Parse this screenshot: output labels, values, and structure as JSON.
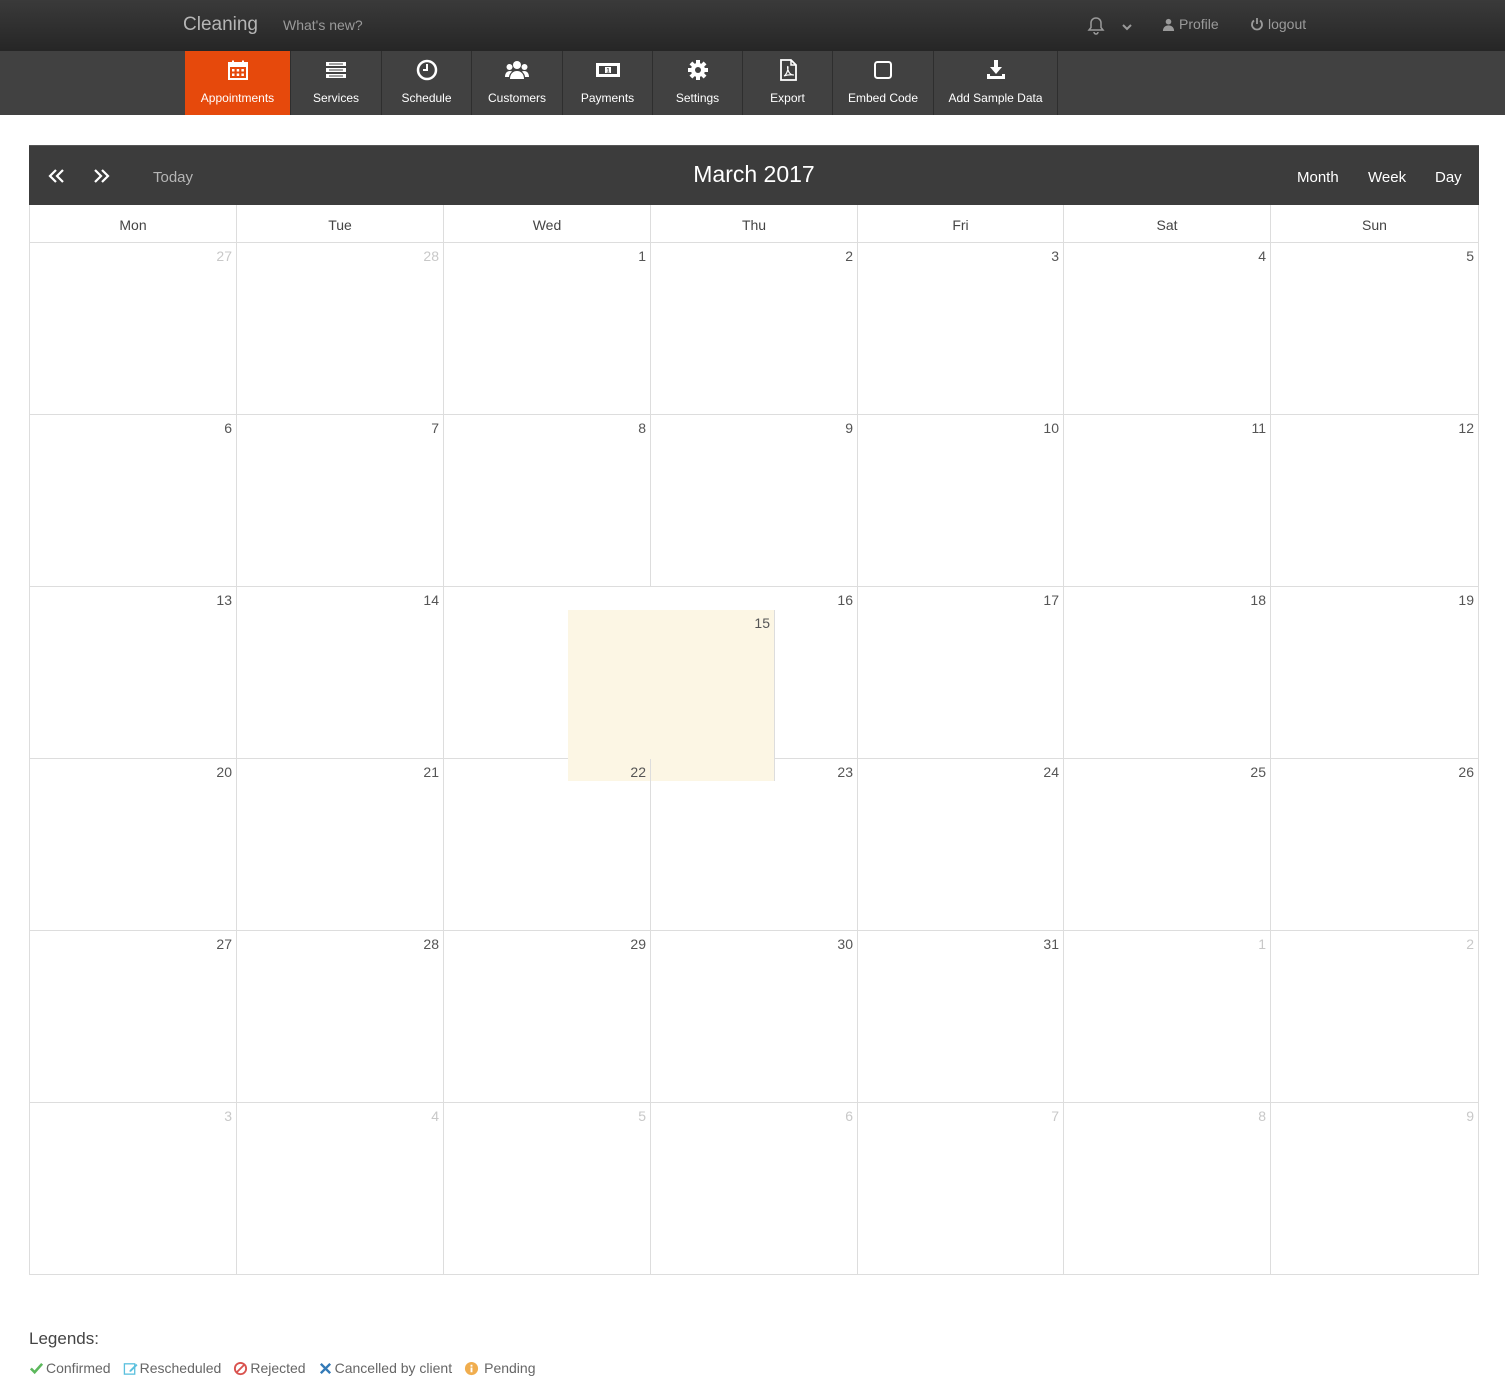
{
  "topbar": {
    "brand": "Cleaning",
    "whats_new": "What's new?",
    "profile": "Profile",
    "logout": "logout"
  },
  "nav": [
    {
      "label": "Appointments",
      "icon": "calendar-icon",
      "active": true
    },
    {
      "label": "Services",
      "icon": "list-icon"
    },
    {
      "label": "Schedule",
      "icon": "clock-icon"
    },
    {
      "label": "Customers",
      "icon": "users-icon"
    },
    {
      "label": "Payments",
      "icon": "money-icon"
    },
    {
      "label": "Settings",
      "icon": "gear-icon"
    },
    {
      "label": "Export",
      "icon": "pdf-file-icon"
    },
    {
      "label": "Embed Code",
      "icon": "square-icon"
    },
    {
      "label": "Add Sample Data",
      "icon": "download-icon"
    }
  ],
  "calendar": {
    "title": "March 2017",
    "today_label": "Today",
    "views": [
      "Month",
      "Week",
      "Day"
    ],
    "days_of_week": [
      "Mon",
      "Tue",
      "Wed",
      "Thu",
      "Fri",
      "Sat",
      "Sun"
    ],
    "weeks": [
      [
        {
          "d": "27",
          "o": true
        },
        {
          "d": "28",
          "o": true
        },
        {
          "d": "1"
        },
        {
          "d": "2"
        },
        {
          "d": "3"
        },
        {
          "d": "4"
        },
        {
          "d": "5"
        }
      ],
      [
        {
          "d": "6"
        },
        {
          "d": "7"
        },
        {
          "d": "8"
        },
        {
          "d": "9"
        },
        {
          "d": "10"
        },
        {
          "d": "11"
        },
        {
          "d": "12"
        }
      ],
      [
        {
          "d": "13"
        },
        {
          "d": "14"
        },
        {
          "d": "15",
          "today": true
        },
        {
          "d": "16"
        },
        {
          "d": "17"
        },
        {
          "d": "18"
        },
        {
          "d": "19"
        }
      ],
      [
        {
          "d": "20"
        },
        {
          "d": "21"
        },
        {
          "d": "22"
        },
        {
          "d": "23"
        },
        {
          "d": "24"
        },
        {
          "d": "25"
        },
        {
          "d": "26"
        }
      ],
      [
        {
          "d": "27"
        },
        {
          "d": "28"
        },
        {
          "d": "29"
        },
        {
          "d": "30"
        },
        {
          "d": "31"
        },
        {
          "d": "1",
          "o": true
        },
        {
          "d": "2",
          "o": true
        }
      ],
      [
        {
          "d": "3",
          "o": true
        },
        {
          "d": "4",
          "o": true
        },
        {
          "d": "5",
          "o": true
        },
        {
          "d": "6",
          "o": true
        },
        {
          "d": "7",
          "o": true
        },
        {
          "d": "8",
          "o": true
        },
        {
          "d": "9",
          "o": true
        }
      ]
    ]
  },
  "legends": {
    "title": "Legends:",
    "items": [
      {
        "label": "Confirmed",
        "icon": "check-icon",
        "color": "#5cb85c"
      },
      {
        "label": "Rescheduled",
        "icon": "edit-icon",
        "color": "#5bc0de"
      },
      {
        "label": "Rejected",
        "icon": "ban-icon",
        "color": "#d9534f"
      },
      {
        "label": "Cancelled by client",
        "icon": "times-icon",
        "color": "#337ab7"
      },
      {
        "label": "Pending",
        "icon": "info-icon",
        "color": "#f0ad4e"
      }
    ]
  }
}
